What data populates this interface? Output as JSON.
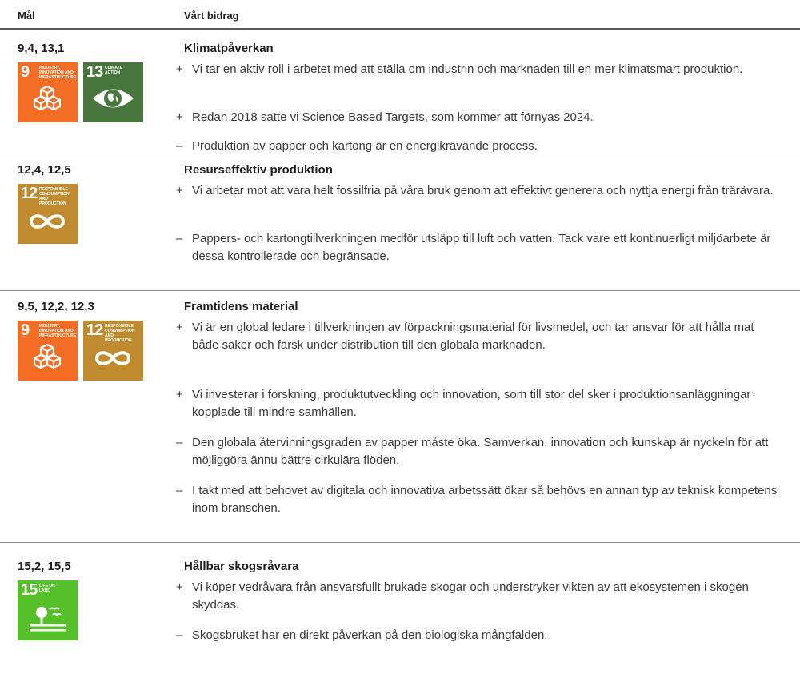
{
  "header": {
    "goal_col": "Mål",
    "contribution_col": "Vårt bidrag"
  },
  "colors": {
    "sdg9": "#F36D25",
    "sdg12": "#BF8B2E",
    "sdg13": "#48773E",
    "sdg15": "#56C02B"
  },
  "sections": [
    {
      "goals": "9,4, 13,1",
      "icons": [
        {
          "number": "9",
          "label": "INDUSTRY, INNOVATION AND INFRASTRUCTURE",
          "icon": "cubes-icon"
        },
        {
          "number": "13",
          "label": "CLIMATE ACTION",
          "icon": "eye-globe-icon"
        }
      ],
      "title": "Klimatpåverkan",
      "bullets": [
        {
          "marker": "+",
          "text": "Vi tar en aktiv roll i arbetet med att ställa om industrin och marknaden till en mer klimatsmart produktion."
        },
        {
          "marker": "+",
          "text": "Redan 2018 satte vi Science Based Targets, som kommer att förnyas 2024."
        },
        {
          "marker": "–",
          "text": "Produktion av papper och kartong är en energikrävande process."
        }
      ]
    },
    {
      "goals": "12,4, 12,5",
      "icons": [
        {
          "number": "12",
          "label": "RESPONSIBLE CONSUMPTION AND PRODUCTION",
          "icon": "infinity-icon"
        }
      ],
      "title": "Resurseffektiv produktion",
      "bullets": [
        {
          "marker": "+",
          "text": "Vi arbetar mot att vara helt fossilfria på våra bruk genom att effektivt generera och nyttja energi från trärävara."
        },
        {
          "marker": "–",
          "text": "Pappers- och kartongtillverkningen medför utsläpp till luft och vatten. Tack vare ett kontinuerligt miljöarbete är dessa kontrollerade och begränsade."
        }
      ]
    },
    {
      "goals": "9,5, 12,2, 12,3",
      "icons": [
        {
          "number": "9",
          "label": "INDUSTRY, INNOVATION AND INFRASTRUCTURE",
          "icon": "cubes-icon"
        },
        {
          "number": "12",
          "label": "RESPONSIBLE CONSUMPTION AND PRODUCTION",
          "icon": "infinity-icon"
        }
      ],
      "title": "Framtidens material",
      "bullets": [
        {
          "marker": "+",
          "text": "Vi är en global ledare i tillverkningen av förpackningsmaterial för livsmedel, och tar ansvar för att hålla mat både säker och färsk under distribution till den globala marknaden."
        },
        {
          "marker": "+",
          "text": "Vi investerar i forskning, produktutveckling och innovation, som till stor del sker i produktionsanläggningar kopplade till mindre samhällen."
        },
        {
          "marker": "–",
          "text": "Den globala återvinningsgraden av papper måste öka. Samverkan, innovation och kunskap är nyckeln för att möjliggöra ännu bättre cirkulära flöden."
        },
        {
          "marker": "–",
          "text": "I takt med att behovet av digitala och innovativa arbetssätt ökar så behövs en annan typ av teknisk kompetens inom branschen."
        }
      ]
    },
    {
      "goals": "15,2, 15,5",
      "icons": [
        {
          "number": "15",
          "label": "LIFE ON LAND",
          "icon": "tree-birds-icon"
        }
      ],
      "title": "Hållbar skogsråvara",
      "bullets": [
        {
          "marker": "+",
          "text": "Vi köper vedråvara från ansvarsfullt brukade skogar och understryker vikten av att ekosystemen i skogen skyddas."
        },
        {
          "marker": "–",
          "text": "Skogsbruket har en direkt påverkan på den biologiska mångfalden."
        }
      ]
    }
  ]
}
